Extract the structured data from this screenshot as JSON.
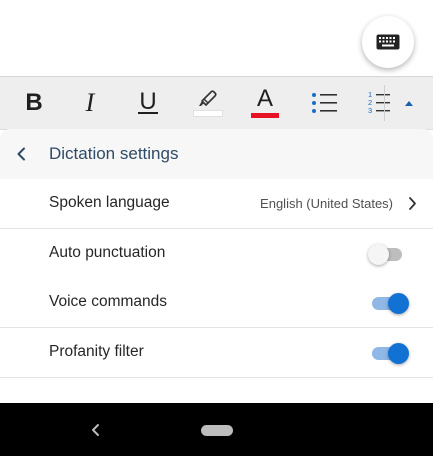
{
  "colors": {
    "accent": "#1272d4",
    "highlight_swatch": "#ffffff",
    "font_color_swatch": "#e81123",
    "title_text": "#2f4a66"
  },
  "icons": {
    "keyboard": "keyboard-icon",
    "bold": "bold-icon",
    "italic": "italic-icon",
    "underline": "underline-icon",
    "highlight": "highlighter-icon",
    "font_color": "font-color-icon",
    "bullets": "bulleted-list-icon",
    "numbering": "numbered-list-icon",
    "expand": "caret-up-icon",
    "back": "chevron-left-icon",
    "navigate": "chevron-right-icon",
    "nav_back": "nav-back-icon",
    "nav_home": "nav-home-pill"
  },
  "toolbar": {
    "bold_label": "B",
    "italic_label": "I",
    "underline_label": "U",
    "font_color_label": "A",
    "numbering_digits": [
      "1",
      "2",
      "3"
    ]
  },
  "panel": {
    "title": "Dictation settings",
    "rows": [
      {
        "label": "Spoken language",
        "value": "English (United States)",
        "type": "link"
      },
      {
        "label": "Auto punctuation",
        "type": "toggle",
        "on": false
      },
      {
        "label": "Voice commands",
        "type": "toggle",
        "on": true
      },
      {
        "label": "Profanity filter",
        "type": "toggle",
        "on": true
      }
    ]
  }
}
